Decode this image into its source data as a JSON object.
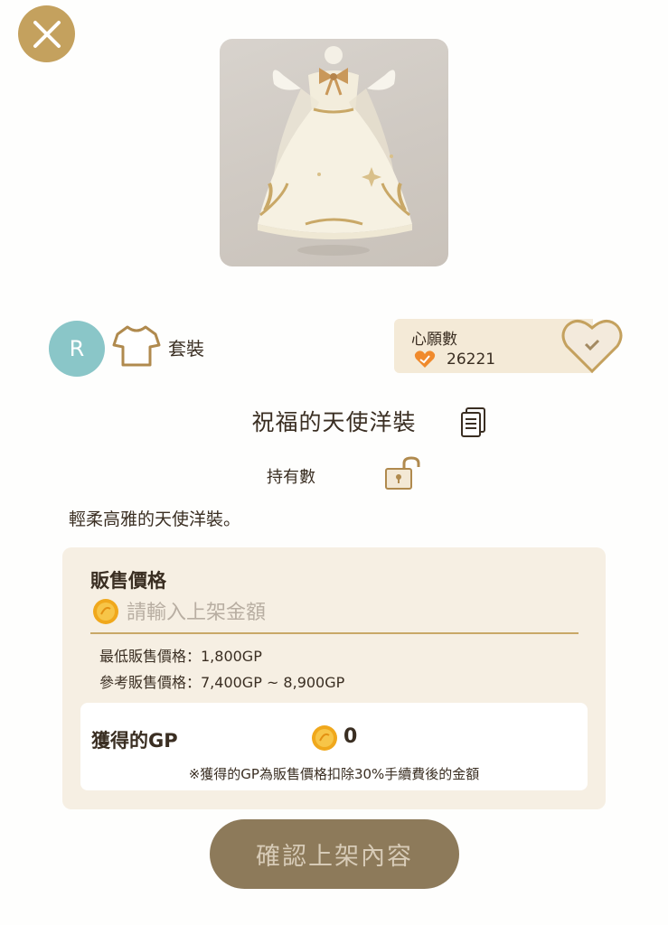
{
  "header": {
    "close_icon": "close-icon"
  },
  "item": {
    "image_name": "dress-image",
    "rarity": "R",
    "category": "套裝",
    "name": "祝福的天使洋裝",
    "owned_label": "持有數",
    "description": "輕柔高雅的天使洋裝。"
  },
  "wishlist": {
    "title": "心願數",
    "count": "26221"
  },
  "sale": {
    "price_title": "販售價格",
    "price_placeholder": "請輸入上架金額",
    "min_price": "最低販售價格：1,800GP",
    "ref_price": "參考販售價格：7,400GP ~ 8,900GP",
    "gp_label": "獲得的GP",
    "gp_value": "0",
    "gp_note": "※獲得的GP為販售價格扣除30%手續費後的金額"
  },
  "confirm_label": "確認上架內容",
  "colors": {
    "gold": "#c4a15e",
    "panel": "#f6efe3",
    "teal": "#8ac6c8",
    "button": "#8d7a5a"
  }
}
